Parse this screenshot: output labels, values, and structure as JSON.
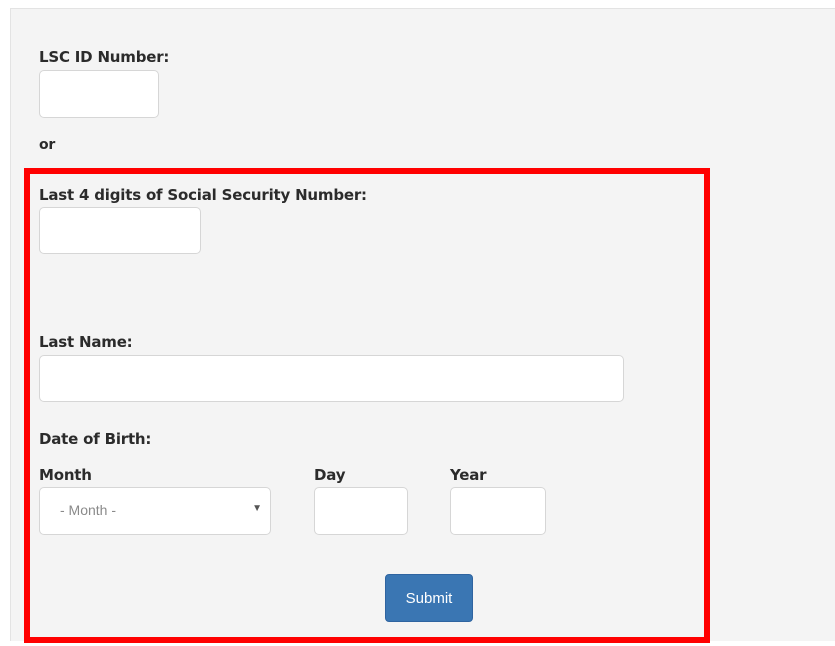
{
  "form": {
    "lsc_id_label": "LSC ID Number:",
    "or_label": "or",
    "ssn_label": "Last 4 digits of Social Security Number:",
    "last_name_label": "Last Name:",
    "dob_label": "Date of Birth:",
    "month_label": "Month",
    "day_label": "Day",
    "year_label": "Year",
    "month_select_value": "- Month -",
    "submit_label": "Submit"
  },
  "annotation": {
    "highlight_color": "#ff0000"
  },
  "colors": {
    "submit_button": "#3a76b3",
    "panel_background": "#f4f4f4"
  }
}
